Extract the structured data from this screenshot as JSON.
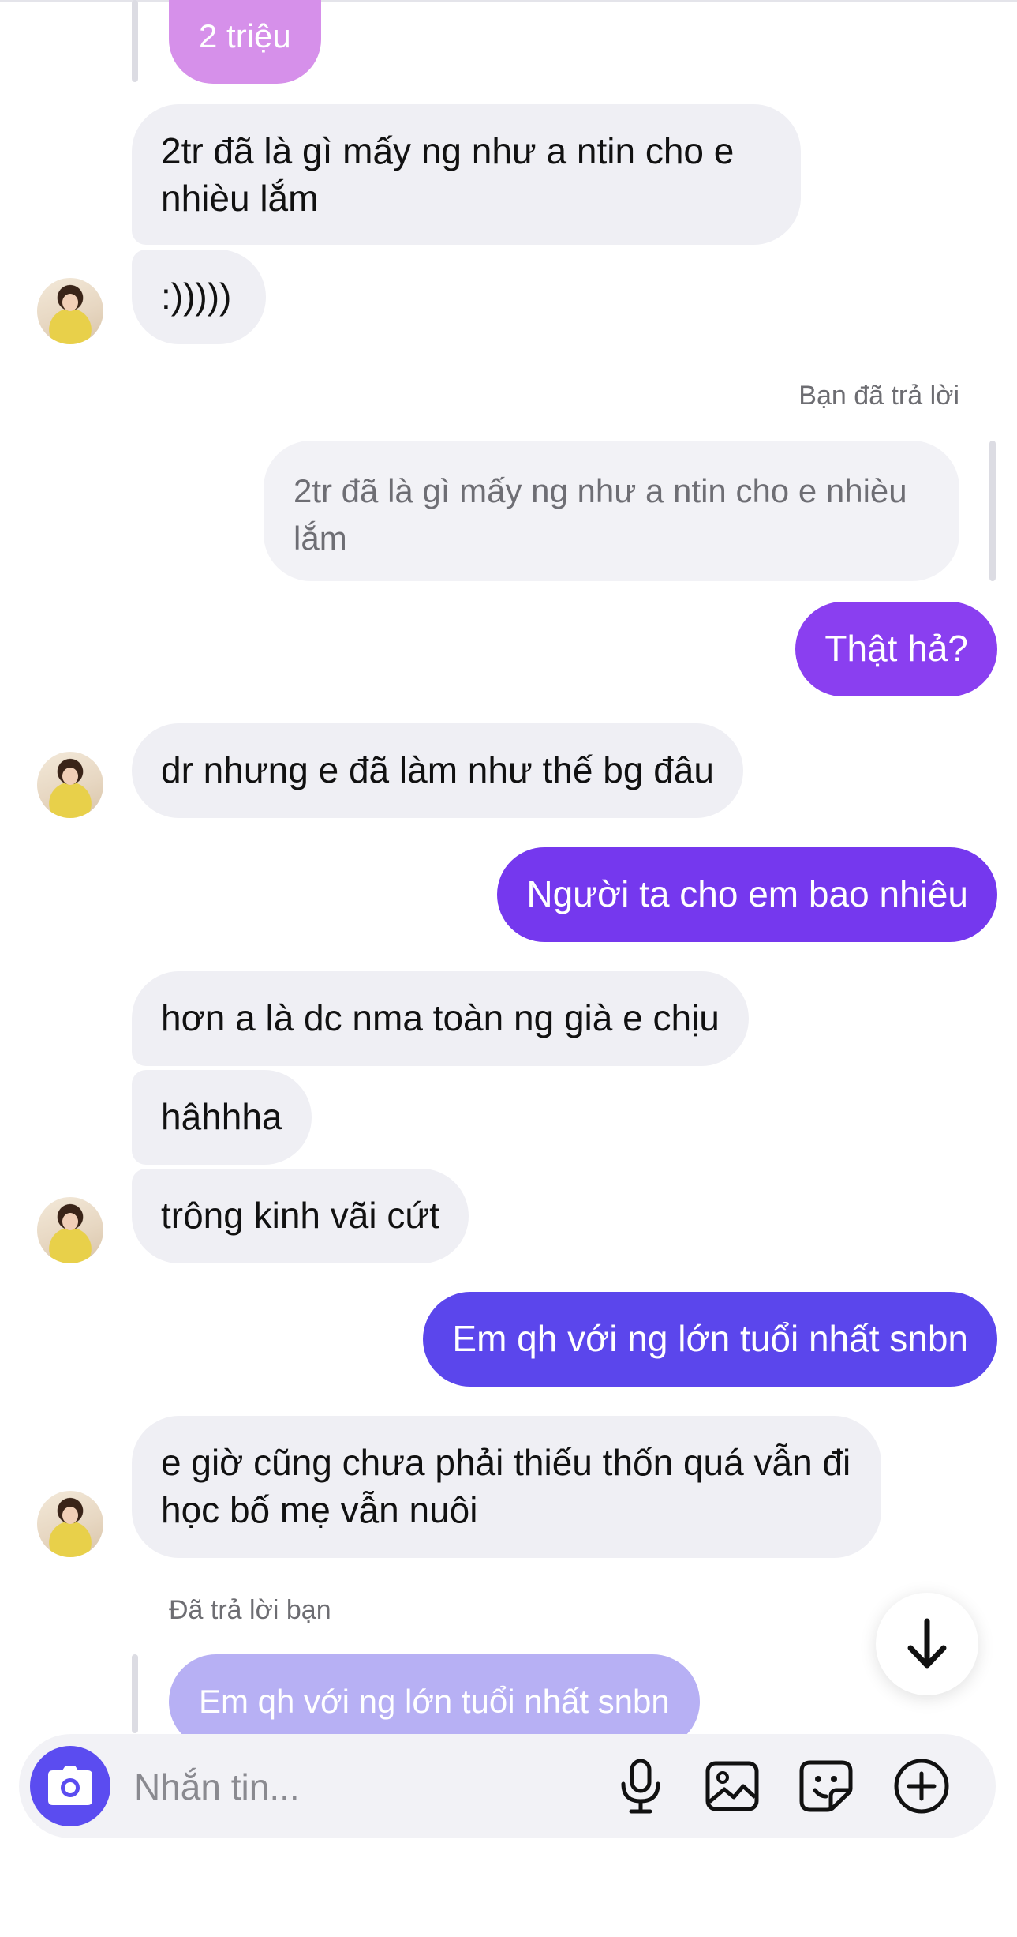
{
  "chat": {
    "quoted_top": "2 triệu",
    "msg1": "2tr đã là gì mấy ng như a ntin cho e nhièu lắm",
    "msg2": ":)))))",
    "reply_caption_me": "Bạn đã trả lời",
    "quoted_me": "2tr đã là gì mấy ng như a ntin cho e nhièu lắm",
    "msg3": "Thật hả?",
    "msg4": "dr nhưng e đã làm như thế bg đâu",
    "msg5": "Người ta cho em bao nhiêu",
    "msg6": "hơn a là dc nma toàn ng già e chịu",
    "msg7": "hâhhha",
    "msg8": "trông kinh vãi cứt",
    "msg9": "Em qh với ng lớn tuổi nhất snbn",
    "msg10": "e giờ cũng chưa phải thiếu thốn quá vẫn đi học bố mẹ vẫn nuôi",
    "reply_caption_them": "Đã trả lời bạn",
    "quoted_bottom": "Em qh với ng lớn tuổi nhất snbn"
  },
  "composer": {
    "placeholder": "Nhắn tin..."
  },
  "icons": {
    "scroll": "arrow-down-icon",
    "camera": "camera-icon",
    "mic": "microphone-icon",
    "gallery": "image-icon",
    "sticker": "sticker-icon",
    "more": "plus-circle-icon"
  },
  "colors": {
    "received_bg": "#efeff4",
    "sent_light": "#8a3ff0",
    "sent_dark": "#5b46ec",
    "quoted_purple": "#d08ee8",
    "quoted_lavender": "#b7b0f4"
  }
}
